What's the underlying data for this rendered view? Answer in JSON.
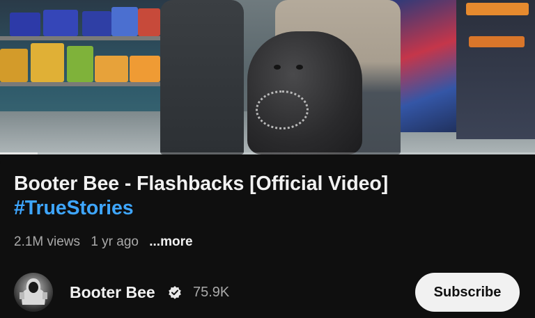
{
  "video": {
    "title": "Booter Bee - Flashbacks [Official Video]",
    "hashtag": "#TrueStories",
    "progress": 0.07
  },
  "meta": {
    "views": "2.1M views",
    "age": "1 yr ago",
    "more": "...more"
  },
  "channel": {
    "name": "Booter Bee",
    "verified_icon": "verified-badge-icon",
    "subscribers": "75.9K",
    "subscribe_label": "Subscribe"
  },
  "colors": {
    "background": "#0f0f0f",
    "hashtag": "#3ea6ff",
    "secondary_text": "#aaaaaa",
    "subscribe_bg": "#f1f1f1"
  }
}
